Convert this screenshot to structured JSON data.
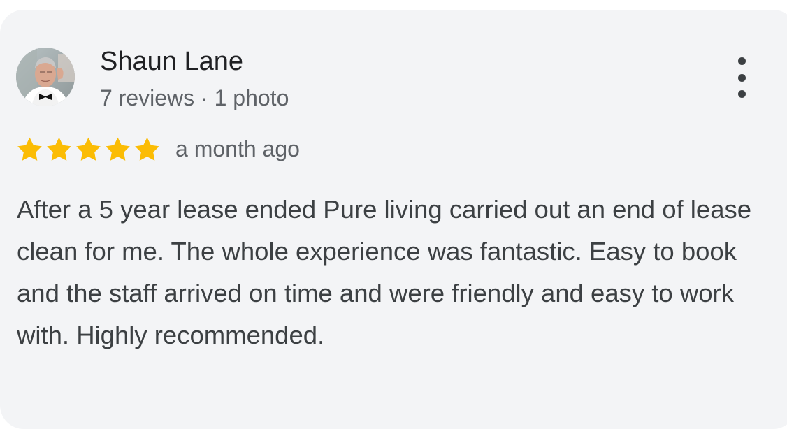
{
  "review": {
    "author_name": "Shaun Lane",
    "author_meta": "7 reviews · 1 photo",
    "rating": 5,
    "rating_max": 5,
    "star_color": "#fbbc04",
    "time_ago": "a month ago",
    "text": "After a 5 year lease ended Pure living carried out an end of lease clean for me. The whole experience was fantastic. Easy to book and the staff arrived on time and were friendly and easy to work with. Highly recommended."
  },
  "icons": {
    "avatar": "profile-photo",
    "menu": "more-vert-icon",
    "star": "star-icon"
  }
}
